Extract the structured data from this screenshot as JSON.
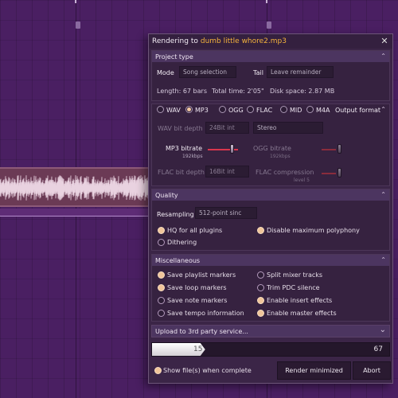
{
  "dialog": {
    "title_prefix": "Rendering to",
    "file_name": "dumb little whore2.mp3",
    "close_glyph": "✕"
  },
  "project_type": {
    "header": "Project type",
    "mode_label": "Mode",
    "mode_value": "Song selection",
    "tail_label": "Tail",
    "tail_value": "Leave remainder",
    "length": "Length: 67 bars",
    "total_time": "Total time: 2'05\"",
    "disk_space": "Disk space: 2.87 MB"
  },
  "output_format": {
    "header": "Output format",
    "formats": [
      {
        "label": "WAV",
        "selected": false
      },
      {
        "label": "MP3",
        "selected": true
      },
      {
        "label": "OGG",
        "selected": false
      },
      {
        "label": "FLAC",
        "selected": false
      },
      {
        "label": "MID",
        "selected": false
      },
      {
        "label": "M4A",
        "selected": false
      }
    ],
    "wav_bit_depth_label": "WAV bit depth",
    "wav_bit_depth_value": "24Bit int",
    "channels_value": "Stereo",
    "mp3_bitrate_label": "MP3 bitrate",
    "mp3_bitrate_value": "192kbps",
    "mp3_bitrate_level": 0.78,
    "ogg_bitrate_label": "OGG bitrate",
    "ogg_bitrate_value": "192kbps",
    "flac_bit_depth_label": "FLAC bit depth",
    "flac_bit_depth_value": "16Bit int",
    "flac_compression_label": "FLAC compression",
    "flac_compression_value": "level 5"
  },
  "quality": {
    "header": "Quality",
    "resampling_label": "Resampling",
    "resampling_value": "512-point sinc",
    "options": [
      {
        "label": "HQ for all plugins",
        "checked": true
      },
      {
        "label": "Disable maximum polyphony",
        "checked": true
      },
      {
        "label": "Dithering",
        "checked": false
      }
    ]
  },
  "misc": {
    "header": "Miscellaneous",
    "options": [
      {
        "label": "Save playlist markers",
        "checked": true
      },
      {
        "label": "Split mixer tracks",
        "checked": false
      },
      {
        "label": "Save loop markers",
        "checked": true
      },
      {
        "label": "Trim PDC silence",
        "checked": false
      },
      {
        "label": "Save note markers",
        "checked": false
      },
      {
        "label": "Enable insert effects",
        "checked": true
      },
      {
        "label": "Save tempo information",
        "checked": false
      },
      {
        "label": "Enable master effects",
        "checked": true
      }
    ]
  },
  "upload": {
    "label": "Upload to 3rd party service...",
    "chevron": "⌄"
  },
  "progress": {
    "current": "15",
    "total": "67",
    "fraction": 0.224
  },
  "footer": {
    "show_files_label": "Show file(s) when complete",
    "show_files_checked": true,
    "render_minimized_label": "Render minimized",
    "abort_label": "Abort"
  },
  "icons": {
    "chevron_up": "⌃"
  },
  "colors": {
    "background": "#4a1f62",
    "dialog_bg": "#3b2547",
    "accent_orange": "#f3b23c",
    "slider_red": "#d9364d"
  }
}
